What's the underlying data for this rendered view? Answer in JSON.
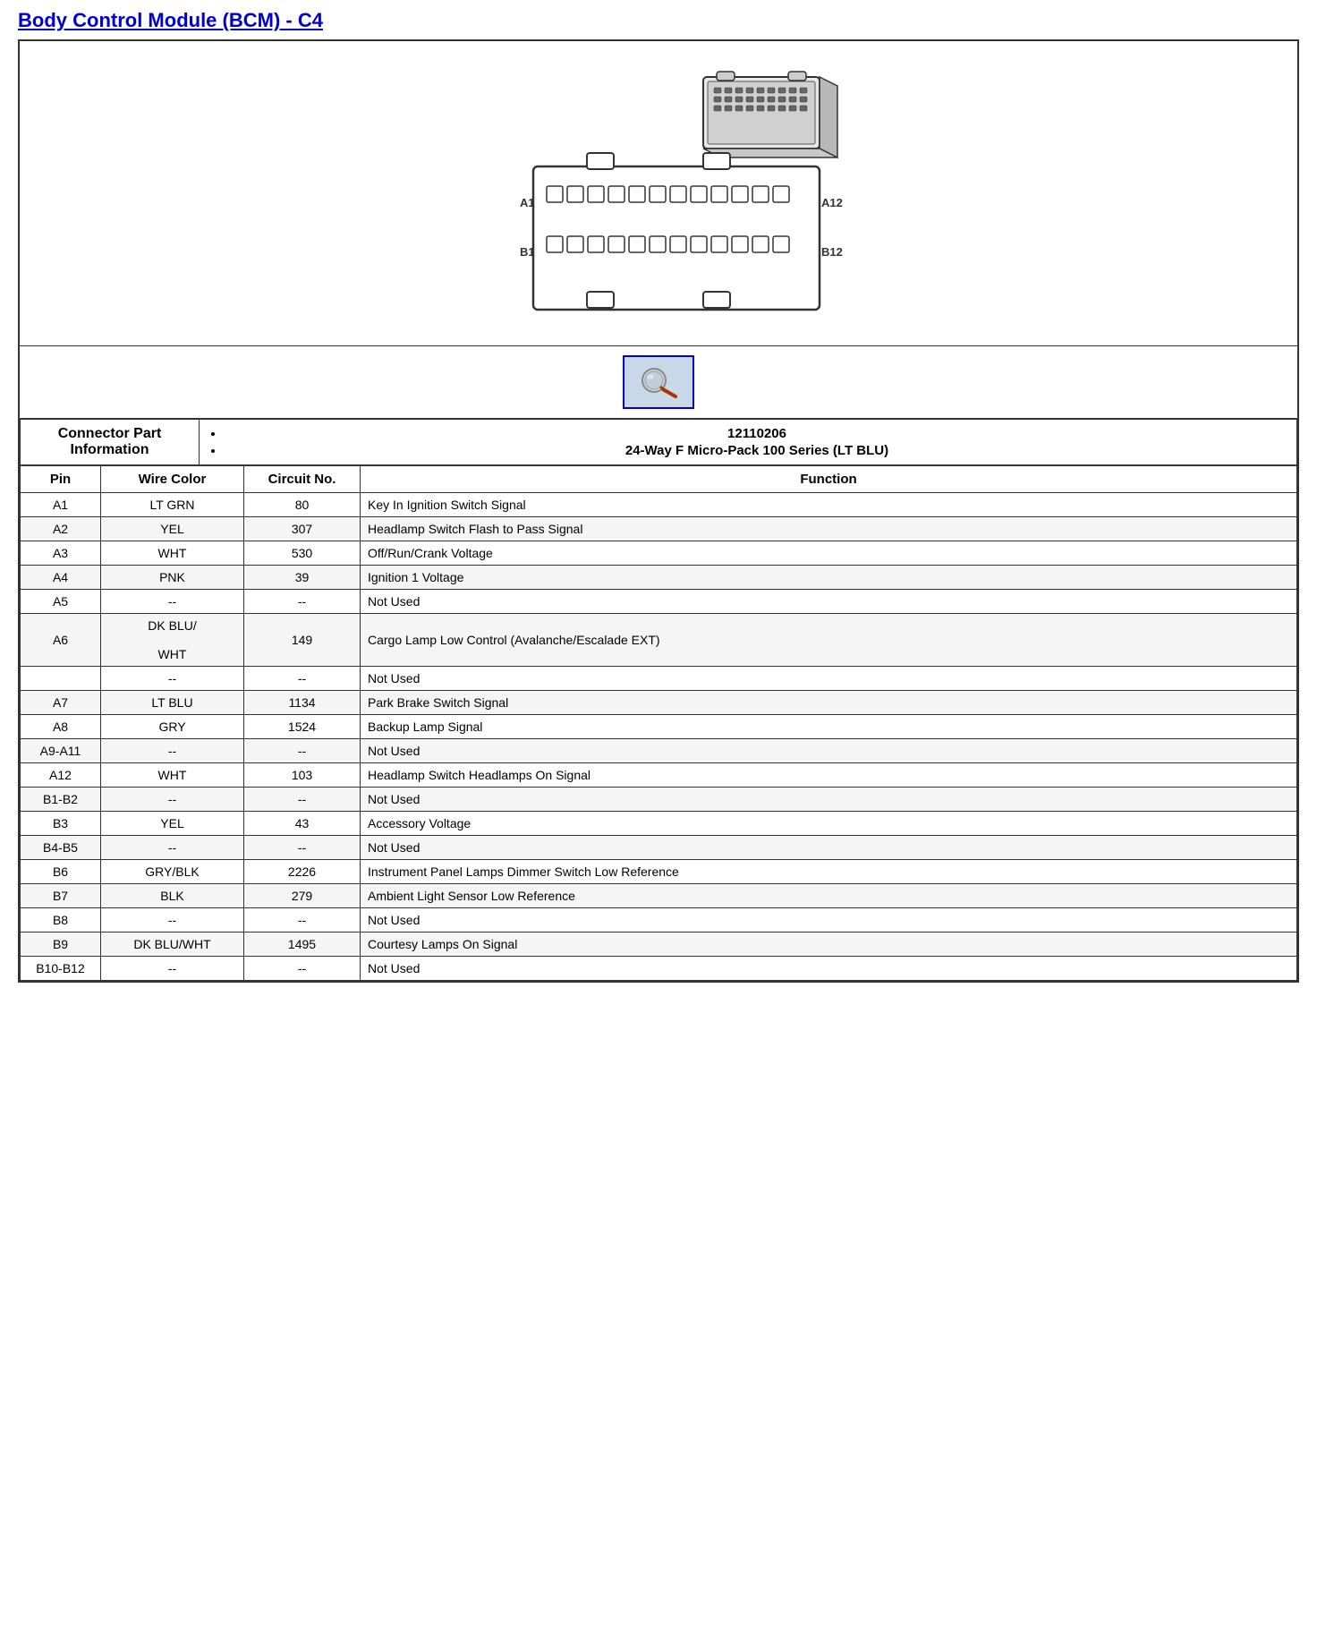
{
  "title": "Body Control Module (BCM) - C4",
  "connector_part_info_label": "Connector Part Information",
  "connector_parts": [
    "12110206",
    "24-Way F Micro-Pack 100 Series (LT BLU)"
  ],
  "table_headers": {
    "pin": "Pin",
    "wire_color": "Wire Color",
    "circuit_no": "Circuit No.",
    "function": "Function"
  },
  "rows": [
    {
      "pin": "A1",
      "wire_color": "LT GRN",
      "circuit_no": "80",
      "function": "Key In Ignition Switch Signal"
    },
    {
      "pin": "A2",
      "wire_color": "YEL",
      "circuit_no": "307",
      "function": "Headlamp Switch Flash to Pass Signal"
    },
    {
      "pin": "A3",
      "wire_color": "WHT",
      "circuit_no": "530",
      "function": "Off/Run/Crank Voltage"
    },
    {
      "pin": "A4",
      "wire_color": "PNK",
      "circuit_no": "39",
      "function": "Ignition 1 Voltage"
    },
    {
      "pin": "A5",
      "wire_color": "--",
      "circuit_no": "--",
      "function": "Not Used"
    },
    {
      "pin": "A6",
      "wire_color": "DK BLU/\nWHT",
      "circuit_no": "149",
      "function": "Cargo Lamp Low Control (Avalanche/Escalade EXT)"
    },
    {
      "pin": "",
      "wire_color": "--",
      "circuit_no": "--",
      "function": "Not Used"
    },
    {
      "pin": "A7",
      "wire_color": "LT BLU",
      "circuit_no": "1134",
      "function": "Park Brake Switch Signal"
    },
    {
      "pin": "A8",
      "wire_color": "GRY",
      "circuit_no": "1524",
      "function": "Backup Lamp Signal"
    },
    {
      "pin": "A9-A11",
      "wire_color": "--",
      "circuit_no": "--",
      "function": "Not Used"
    },
    {
      "pin": "A12",
      "wire_color": "WHT",
      "circuit_no": "103",
      "function": "Headlamp Switch Headlamps On Signal"
    },
    {
      "pin": "B1-B2",
      "wire_color": "--",
      "circuit_no": "--",
      "function": "Not Used"
    },
    {
      "pin": "B3",
      "wire_color": "YEL",
      "circuit_no": "43",
      "function": "Accessory Voltage"
    },
    {
      "pin": "B4-B5",
      "wire_color": "--",
      "circuit_no": "--",
      "function": "Not Used"
    },
    {
      "pin": "B6",
      "wire_color": "GRY/BLK",
      "circuit_no": "2226",
      "function": "Instrument Panel Lamps Dimmer Switch Low Reference"
    },
    {
      "pin": "B7",
      "wire_color": "BLK",
      "circuit_no": "279",
      "function": "Ambient Light Sensor Low Reference"
    },
    {
      "pin": "B8",
      "wire_color": "--",
      "circuit_no": "--",
      "function": "Not Used"
    },
    {
      "pin": "B9",
      "wire_color": "DK BLU/WHT",
      "circuit_no": "1495",
      "function": "Courtesy Lamps On Signal"
    },
    {
      "pin": "B10-B12",
      "wire_color": "--",
      "circuit_no": "--",
      "function": "Not Used"
    }
  ]
}
